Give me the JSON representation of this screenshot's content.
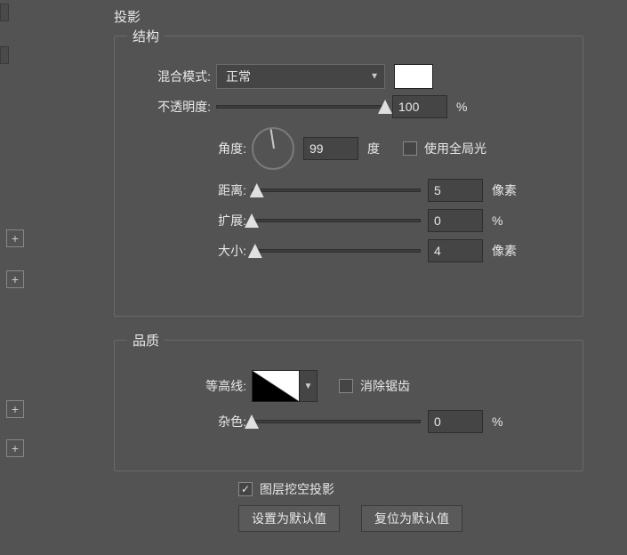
{
  "left_strip": {
    "plus_positions": [
      258,
      304,
      450,
      494
    ]
  },
  "title": "投影",
  "structure": {
    "legend": "结构",
    "blend_mode_label": "混合模式:",
    "blend_mode_value": "正常",
    "color_swatch": "#ffffff",
    "opacity_label": "不透明度:",
    "opacity_value": "100",
    "opacity_unit": "%",
    "angle_label": "角度:",
    "angle_value": "99",
    "angle_unit": "度",
    "global_light_label": "使用全局光",
    "global_light_checked": false,
    "distance_label": "距离:",
    "distance_value": "5",
    "distance_unit": "像素",
    "spread_label": "扩展:",
    "spread_value": "0",
    "spread_unit": "%",
    "size_label": "大小:",
    "size_value": "4",
    "size_unit": "像素"
  },
  "quality": {
    "legend": "品质",
    "contour_label": "等高线:",
    "antialias_label": "消除锯齿",
    "antialias_checked": false,
    "noise_label": "杂色:",
    "noise_value": "0",
    "noise_unit": "%"
  },
  "footer": {
    "knockout_label": "图层挖空投影",
    "knockout_checked": true,
    "make_default": "设置为默认值",
    "reset_default": "复位为默认值"
  }
}
